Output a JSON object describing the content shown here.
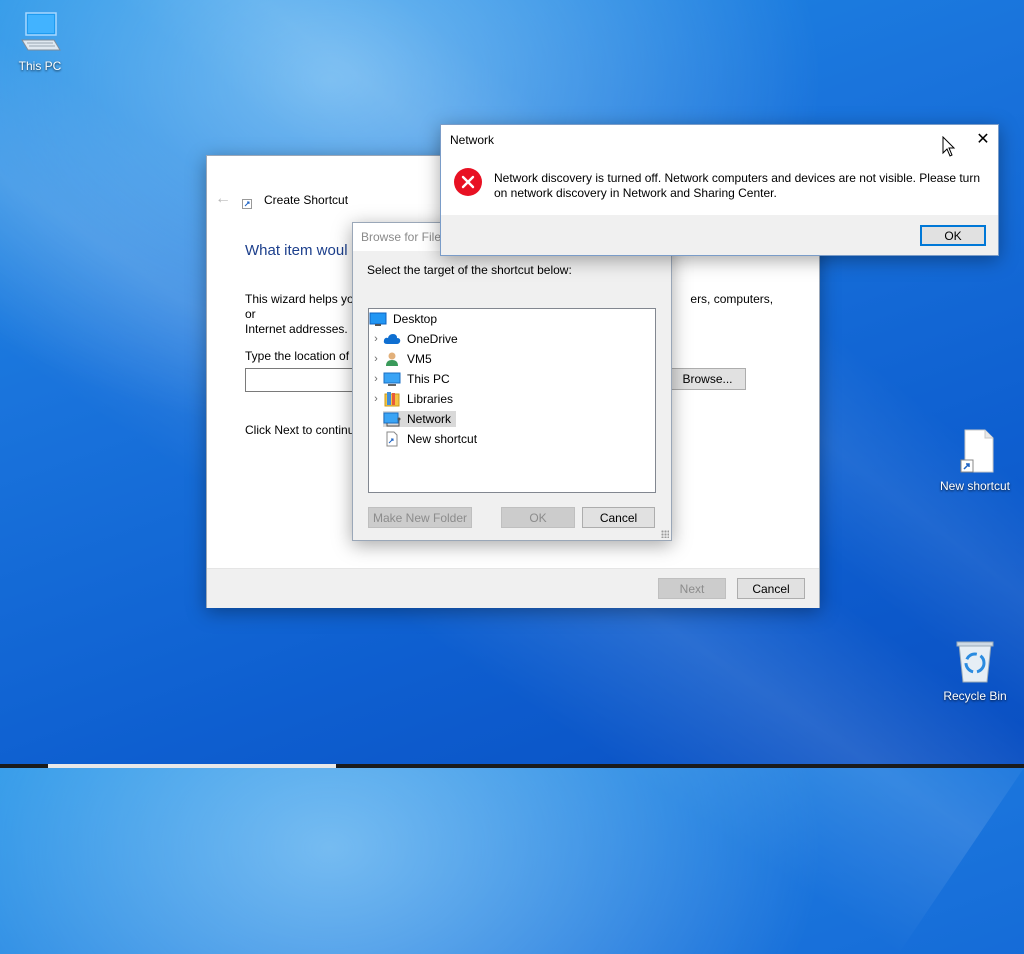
{
  "desktop": {
    "icons": [
      {
        "label": "This PC",
        "icon": "this-pc-icon"
      },
      {
        "label": "New shortcut",
        "icon": "shortcut-file-icon"
      },
      {
        "label": "Recycle Bin",
        "icon": "recycle-bin-icon"
      }
    ]
  },
  "wizard": {
    "title": "Create Shortcut",
    "heading": "What item woul",
    "description": "This wizard helps you create shortcuts to local or network programs, files, folders, computers, or Internet addresses.",
    "description_visible_left": "This wizard helps you",
    "description_visible_right": "ers, computers, or",
    "description_line2": "Internet addresses.",
    "location_label": "Type the location of t",
    "location_value": "",
    "browse_label": "Browse...",
    "next_hint": "Click Next to continu",
    "next_label": "Next",
    "cancel_label": "Cancel"
  },
  "browse": {
    "title": "Browse for Files",
    "prompt": "Select the target of the shortcut below:",
    "tree": [
      {
        "label": "Desktop",
        "icon": "desktop-icon",
        "expandable": false,
        "level": 0,
        "selected": false
      },
      {
        "label": "OneDrive",
        "icon": "onedrive-icon",
        "expandable": true,
        "level": 1,
        "selected": false
      },
      {
        "label": "VM5",
        "icon": "user-icon",
        "expandable": true,
        "level": 1,
        "selected": false
      },
      {
        "label": "This PC",
        "icon": "this-pc-icon",
        "expandable": true,
        "level": 1,
        "selected": false
      },
      {
        "label": "Libraries",
        "icon": "libraries-icon",
        "expandable": true,
        "level": 1,
        "selected": false
      },
      {
        "label": "Network",
        "icon": "network-icon",
        "expandable": false,
        "level": 1,
        "selected": true
      },
      {
        "label": "New shortcut",
        "icon": "shortcut-file-icon",
        "expandable": false,
        "level": 1,
        "selected": false
      }
    ],
    "make_folder_label": "Make New Folder",
    "ok_label": "OK",
    "cancel_label": "Cancel"
  },
  "network_dialog": {
    "title": "Network",
    "message": "Network discovery is turned off. Network computers and devices are not visible. Please turn on network discovery in Network and Sharing Center.",
    "ok_label": "OK",
    "icon": "error-icon"
  },
  "colors": {
    "accent": "#0078d7",
    "heading": "#1c3f8c",
    "error": "#e81123"
  }
}
